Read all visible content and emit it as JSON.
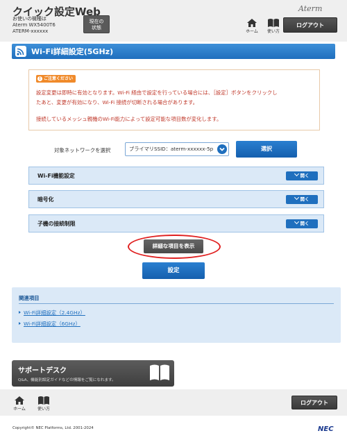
{
  "header": {
    "app_title": "クイック設定Web",
    "device_line1": "お使いの機種は",
    "device_line2": "Aterm WX5400T6",
    "device_line3": "ATERM-xxxxxx",
    "status_line1": "現在の",
    "status_line2": "状態",
    "brand": "Aterm",
    "home_label": "ホーム",
    "manual_label": "使い方",
    "logout_label": "ログアウト"
  },
  "page": {
    "title": "Wi-Fi詳細設定(5GHz)"
  },
  "notice": {
    "badge": "ご注意ください",
    "badge_icon": "!",
    "line1": "設定変更は即時に有効となります。Wi-Fi 経由で設定を行っている場合には、［設定］ボタンをクリックし",
    "line2": "たあと、変更が有効になり、Wi-Fi 接続が切断される場合があります。",
    "line3": "接続しているメッシュ親機のWi-Fi能力によって設定可能な項目数が変化します。"
  },
  "network": {
    "label": "対象ネットワークを選択",
    "selected": "プライマリSSID：aterm-xxxxxx-5p",
    "select_button": "選択"
  },
  "accordions": [
    {
      "label": "Wi-Fi機能設定",
      "button": "開く"
    },
    {
      "label": "暗号化",
      "button": "開く"
    },
    {
      "label": "子機の接続制限",
      "button": "開く"
    }
  ],
  "actions": {
    "detail_button": "詳細な項目を表示",
    "settings_button": "設定"
  },
  "related": {
    "title": "関連項目",
    "links": [
      "Wi-Fi詳細設定（2.4GHz）",
      "Wi-Fi詳細設定（6GHz）"
    ]
  },
  "support": {
    "title": "サポートデスク",
    "subtitle": "Q&A、機能別設定ガイドなどの情報をご覧になれます。"
  },
  "footer": {
    "home_label": "ホーム",
    "manual_label": "使い方",
    "logout_label": "ログアウト",
    "copyright": "Copyright© NEC Platforms, Ltd. 2001-2024",
    "brand": "NEC"
  },
  "colors": {
    "primary_blue": "#1f6fbe",
    "notice_red": "#c0392b",
    "badge_orange": "#f08a2a",
    "highlight_red": "#e02020",
    "panel_blue": "#dbe9f7"
  }
}
